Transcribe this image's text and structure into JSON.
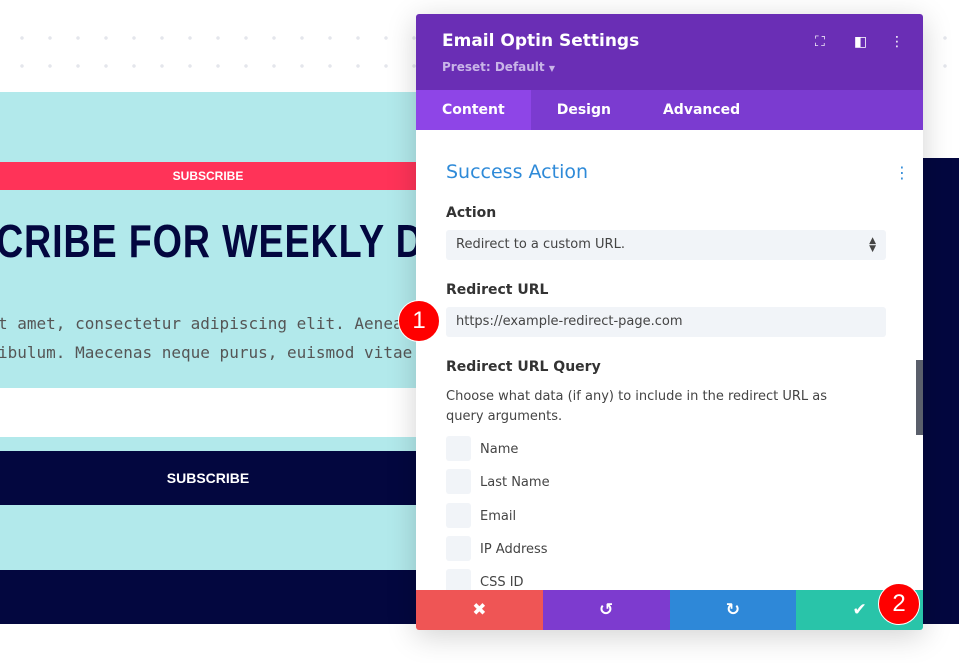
{
  "background": {
    "top_button": "SUBSCRIBE",
    "headline": "CRIBE FOR WEEKLY DEA",
    "paragraph_line1": "t amet, consectetur adipiscing elit. Aenea",
    "paragraph_line2": "ibulum. Maecenas neque purus, euismod vitae",
    "subscribe_button": "SUBSCRIBE"
  },
  "panel": {
    "title": "Email Optin Settings",
    "preset": "Preset: Default",
    "header_icons": [
      "focus-icon",
      "sidebar-layout-icon",
      "more-vertical-icon"
    ],
    "tabs": [
      {
        "label": "Content",
        "active": true
      },
      {
        "label": "Design"
      },
      {
        "label": "Advanced"
      }
    ],
    "section_title": "Success Action",
    "action_label": "Action",
    "action_value": "Redirect to a custom URL.",
    "redirect_url_label": "Redirect URL",
    "redirect_url_value": "https://example-redirect-page.com",
    "query_label": "Redirect URL Query",
    "query_desc": "Choose what data (if any) to include in the redirect URL as query arguments.",
    "query_options": [
      {
        "label": "Name",
        "checked": false
      },
      {
        "label": "Last Name",
        "checked": false
      },
      {
        "label": "Email",
        "checked": false
      },
      {
        "label": "IP Address",
        "checked": false
      },
      {
        "label": "CSS ID",
        "checked": false
      }
    ],
    "footer": {
      "cancel": "✖",
      "undo": "↺",
      "redo": "↻",
      "save": "✔"
    }
  },
  "badges": [
    "1",
    "2"
  ],
  "colors": {
    "purple": "#6a2eb5",
    "tab": "#7b3bd0",
    "cancel": "#ef5555",
    "undo": "#7d3bcf",
    "redo": "#2e88d8",
    "save": "#29c4a9",
    "accent": "#2e8ad8",
    "cyan": "#b2e9eb",
    "navy": "#03073f",
    "pink": "#ff3358"
  }
}
